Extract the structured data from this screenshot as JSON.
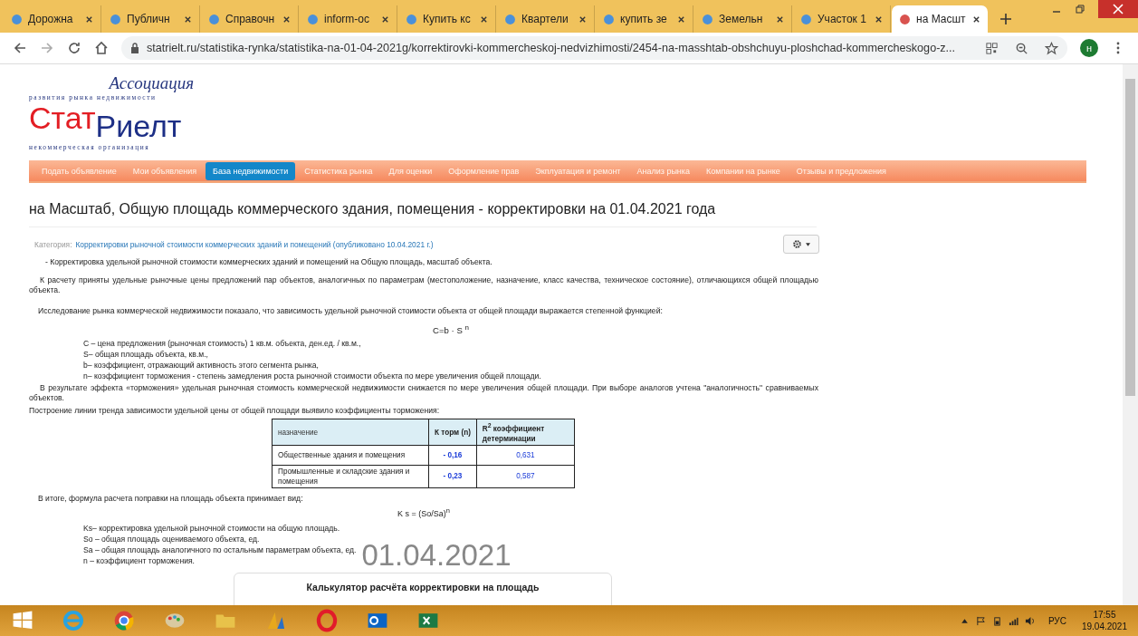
{
  "browser": {
    "tabs": [
      {
        "title": "Дорожна",
        "selected": false
      },
      {
        "title": "Публичн",
        "selected": false
      },
      {
        "title": "Справочн",
        "selected": false
      },
      {
        "title": "inform-oc",
        "selected": false
      },
      {
        "title": "Купить кс",
        "selected": false
      },
      {
        "title": "Квартели",
        "selected": false
      },
      {
        "title": "купить зе",
        "selected": false
      },
      {
        "title": "Земельн",
        "selected": false
      },
      {
        "title": "Участок 1",
        "selected": false
      },
      {
        "title": "на Масшт",
        "selected": true
      }
    ],
    "address": "statrielt.ru/statistika-rynka/statistika-na-01-04-2021g/korrektirovki-kommercheskoj-nedvizhimosti/2454-na-masshtab-obshchuyu-ploshchad-kommercheskogo-z...",
    "profile_letter": "н"
  },
  "page": {
    "logo": {
      "association": "Ассоциация",
      "tagline": "развития рынка недвижимости",
      "name_first": "Стат",
      "name_second": "Риелт",
      "subtitle": "некоммерческая организация"
    },
    "nav": [
      {
        "label": "Подать объявление",
        "selected": false
      },
      {
        "label": "Мои объявления",
        "selected": false
      },
      {
        "label": "База недвижимости",
        "selected": true
      },
      {
        "label": "Статистика рынка",
        "selected": false
      },
      {
        "label": "Для оценки",
        "selected": false
      },
      {
        "label": "Оформление прав",
        "selected": false
      },
      {
        "label": "Экплуатация и ремонт",
        "selected": false
      },
      {
        "label": "Анализ рынка",
        "selected": false
      },
      {
        "label": "Компании на рынке",
        "selected": false
      },
      {
        "label": "Отзывы и предложения",
        "selected": false
      }
    ],
    "title": "на Масштаб, Общую площадь коммерческого здания, помещения - корректировки на 01.04.2021 года",
    "category_label": "Категория:",
    "category_link": "Корректировки рыночной стоимости коммерческих зданий и помещений (опубликовано 10.04.2021 г.)",
    "intro": "- Корректировка удельной рыночной стоимости коммерческих зданий и помещений на Общую площадь, масштаб объекта.",
    "basis": "К расчету приняты удельные рыночные цены предложений пар объектов, аналогичных по параметрам (местоположение, назначение, класс качества, техническое состояние), отличающихся общей площадью объекта.",
    "research": "Исследование рынка коммерческой недвижимости показало, что зависимость удельной рыночной стоимости объекта от общей площади выражается степенной функцией:",
    "formula": "C=b · S $^{n}$",
    "definitions": [
      "C – цена предложения (рыночная стоимость) 1 кв.м. объекта, ден.ед. / кв.м.,",
      "S– общая площадь объекта, кв.м.,",
      "b– коэффициент, отражающий активность этого сегмента рынка,",
      "n– коэффициент торможения - степень замедления роста рыночной стоимости объекта по мере увеличения общей площади."
    ],
    "effect": "В результате эффекта «торможения» удельная рыночная стоимость коммерческой недвижимости снижается по мере увеличения общей площади. При выборе аналогов учтена \"аналогичность\" сравниваемых объектов.",
    "trend": "Построение линии тренда зависимости удельной цены от общей площади выявило коэффициенты торможения:",
    "table": {
      "columns": [
        "назначение",
        "К торм (n)",
        "R$^{2}$ коэффициент детерминации"
      ],
      "rows": [
        [
          "Общественные здания и помещения",
          "- 0,16",
          "0,631"
        ],
        [
          "Промышленные и складские здания и помещения",
          "- 0,23",
          "0,587"
        ]
      ]
    },
    "summary": "В итоге, формула расчета поправки на площадь объекта принимает вид:",
    "formula_2": "K s = (So/Sa)$^{n}$",
    "definitions_2": [
      "Ks– корректировка удельной рыночной стоимости на общую площадь.",
      "So – общая площадь оцениваемого объекта, ед.",
      "Sa – общая площадь аналогичного по остальным параметрам объекта, ед.",
      "n – коэффициент торможения."
    ],
    "date_stamp": "01.04.2021",
    "calculator_title": "Калькулятор расчёта корректировки на площадь"
  },
  "taskbar": {
    "language": "РУС",
    "time": "17:55",
    "date": "19.04.2021"
  }
}
